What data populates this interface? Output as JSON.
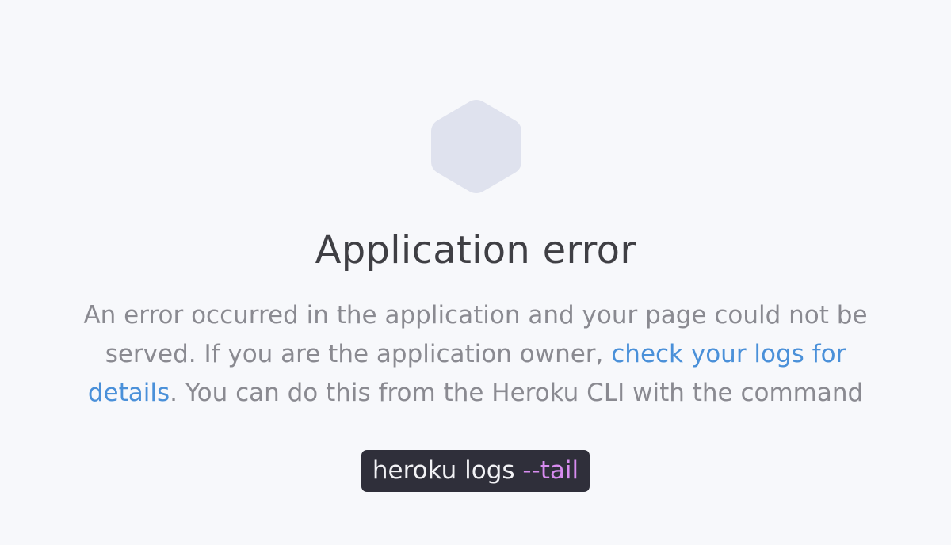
{
  "logo": {
    "icon": "hexagon-icon",
    "color": "#dfe2ee"
  },
  "title": "Application error",
  "message": {
    "part1": "An error occurred in the application and your page could not be served. If you are the application owner, ",
    "link_text": "check your logs for details",
    "part2": ". You can do this from the Heroku CLI with the command"
  },
  "command": {
    "base": "heroku logs ",
    "flag": "--tail"
  },
  "colors": {
    "background": "#f7f8fb",
    "link": "#4a90d9",
    "command_bg": "#2f2f3a",
    "flag": "#d88cf0"
  }
}
